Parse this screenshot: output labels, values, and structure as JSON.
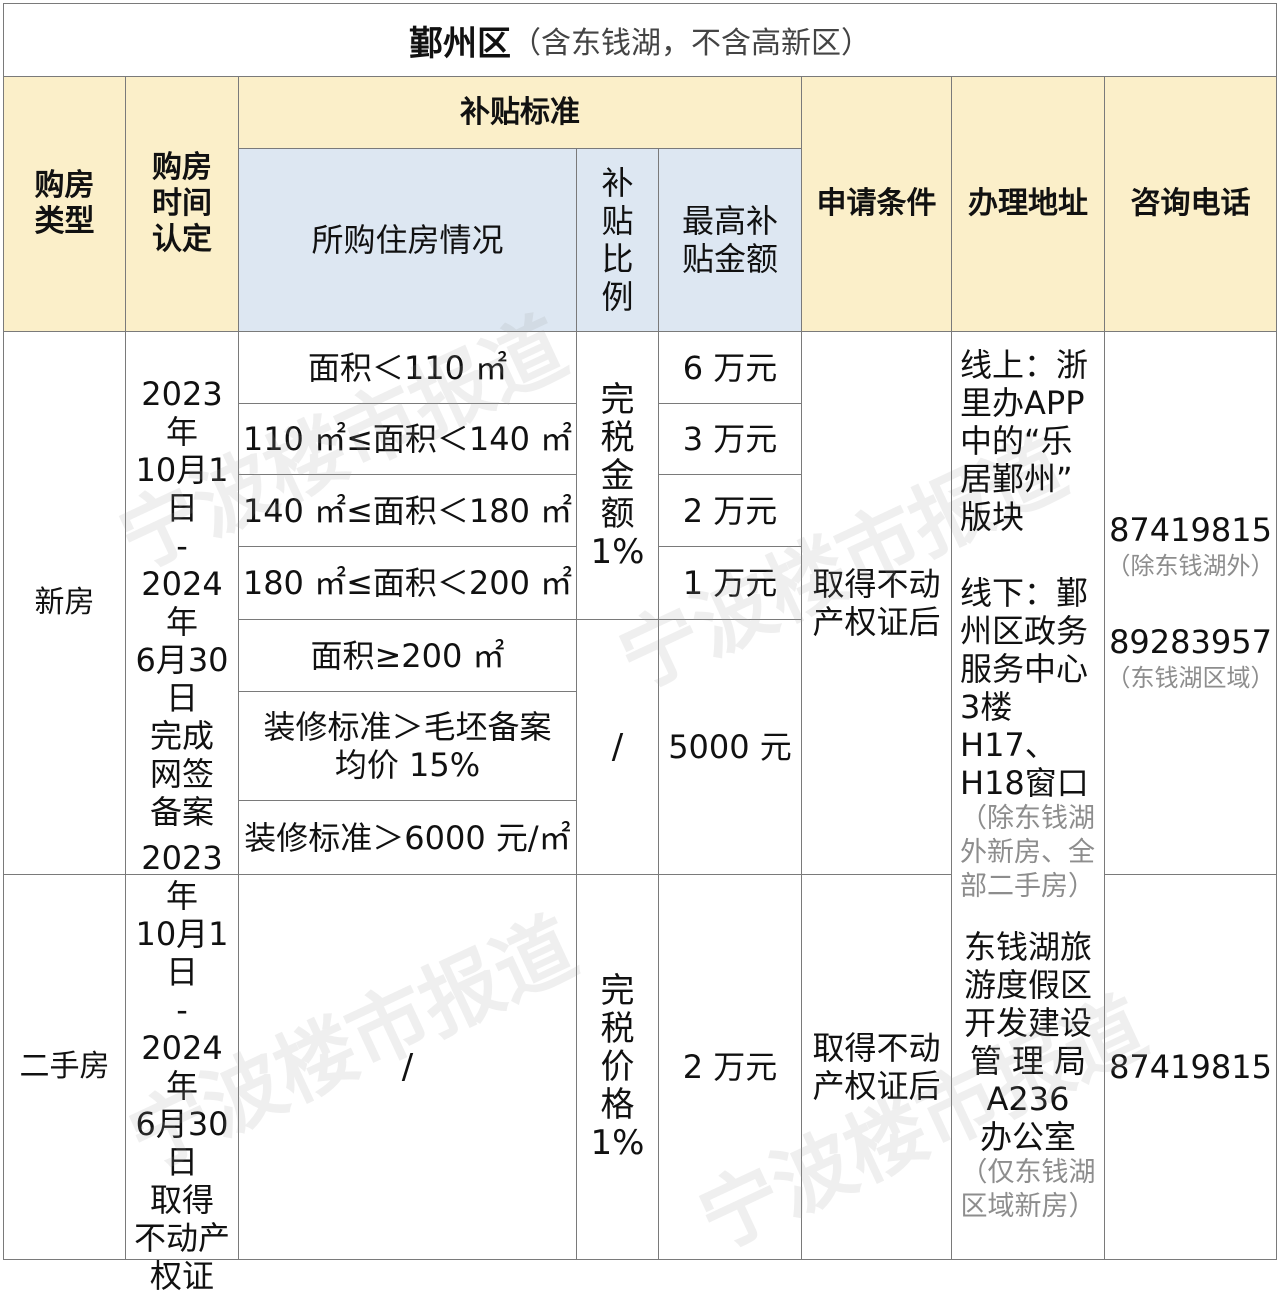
{
  "title": {
    "main": "鄞州区",
    "note": "（含东钱湖，不含高新区）"
  },
  "headers": {
    "type": "购房类型",
    "time": "购房时间认定",
    "standard": "补贴标准",
    "situation": "所购住房情况",
    "ratio": "补贴比例",
    "max": "最高补贴金额",
    "condition": "申请条件",
    "address": "办理地址",
    "phone": "咨询电话"
  },
  "new_house": {
    "type": "新房",
    "time_lines": [
      "2023年",
      "10月1日",
      "-",
      "2024年",
      "6月30日",
      "完成",
      "网签",
      "备案"
    ],
    "areas": [
      "面积＜110 ㎡",
      "110 ㎡≤面积＜140 ㎡",
      "140 ㎡≤面积＜180 ㎡",
      "180 ㎡≤面积＜200 ㎡",
      "面积≥200 ㎡"
    ],
    "amounts": [
      "6 万元",
      "3 万元",
      "2 万元",
      "1 万元"
    ],
    "ratio_lines": [
      "完",
      "税",
      "金",
      "额",
      "1%"
    ],
    "deco1_lines": [
      "装修标准＞毛坯备案",
      "均价 15%"
    ],
    "deco2": "装修标准＞6000 元/㎡",
    "deco_ratio": "/",
    "deco_amount": "5000 元",
    "condition_lines": [
      "取得不动",
      "产权证后"
    ],
    "online_lines": [
      "线上：浙",
      "里办APP",
      "中的“乐",
      "居鄞州”",
      "版块"
    ],
    "offline_lines": [
      "线下：鄞",
      "州区政务",
      "服务中心",
      "3楼H17、",
      "H18窗口"
    ],
    "offline_note_lines": [
      "（除东钱湖",
      "外新房、全",
      "部二手房）"
    ],
    "phone1": "87419815",
    "phone1_note": "（除东钱湖外）",
    "phone2": "89283957",
    "phone2_note": "（东钱湖区域）"
  },
  "second_house": {
    "type": "二手房",
    "time_lines": [
      "2023年",
      "10月1日",
      "-",
      "2024年",
      "6月30日",
      "取得",
      "不动产",
      "权证"
    ],
    "situation": "/",
    "ratio_lines": [
      "完",
      "税",
      "价",
      "格",
      "1%"
    ],
    "amount": "2 万元",
    "condition_lines": [
      "取得不动",
      "产权证后"
    ],
    "address_lines": [
      "东钱湖旅",
      "游度假区",
      "开发建设",
      "管 理 局",
      "A236",
      "办公室"
    ],
    "address_note_lines": [
      "（仅东钱湖",
      "区域新房）"
    ],
    "phone": "87419815"
  },
  "watermark": "宁波楼市报道"
}
